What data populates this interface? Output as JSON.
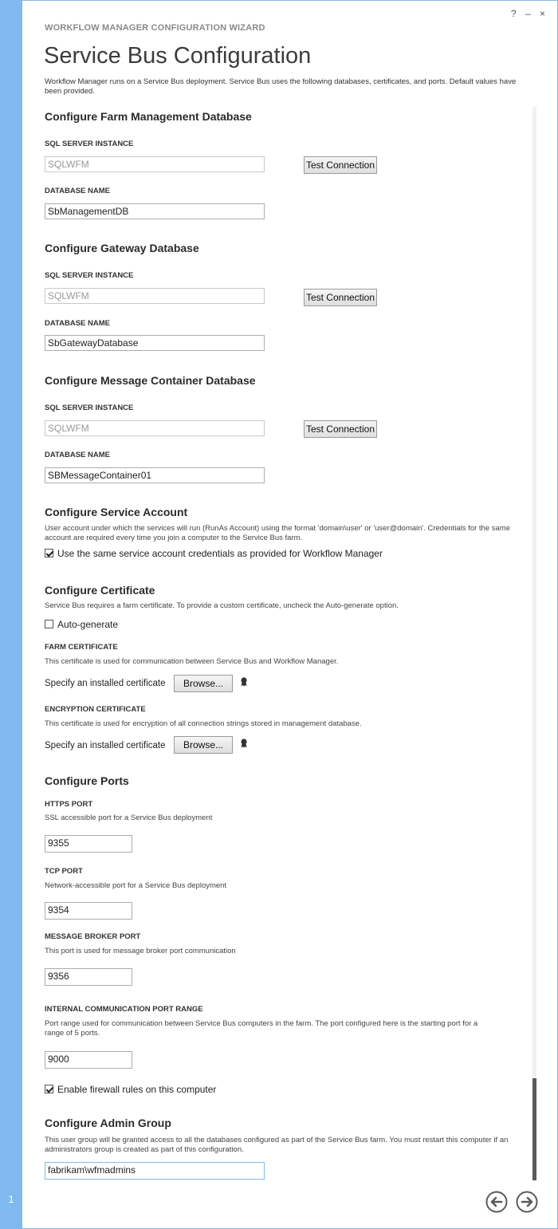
{
  "window": {
    "controls": [
      "?",
      "–",
      "×"
    ],
    "step_number": "1"
  },
  "header": {
    "wizard_title": "WORKFLOW MANAGER CONFIGURATION WIZARD",
    "page_title": "Service Bus Configuration",
    "intro": "Workflow Manager runs on a Service Bus deployment. Service Bus uses the following databases, certificates, and ports. Default values have been provided."
  },
  "farm_db": {
    "heading": "Configure Farm Management Database",
    "sql_label": "SQL SERVER INSTANCE",
    "sql_value": "SQLWFM",
    "test_button": "Test Connection",
    "db_label": "DATABASE NAME",
    "db_value": "SbManagementDB"
  },
  "gateway_db": {
    "heading": "Configure Gateway Database",
    "sql_label": "SQL SERVER INSTANCE",
    "sql_value": "SQLWFM",
    "test_button": "Test Connection",
    "db_label": "DATABASE NAME",
    "db_value": "SbGatewayDatabase"
  },
  "message_db": {
    "heading": "Configure Message Container Database",
    "sql_label": "SQL SERVER INSTANCE",
    "sql_value": "SQLWFM",
    "test_button": "Test Connection",
    "db_label": "DATABASE NAME",
    "db_value": "SBMessageContainer01"
  },
  "service_account": {
    "heading": "Configure Service Account",
    "desc": "User account under which the services will run (RunAs Account) using the format 'domain\\user' or 'user@domain'. Credentials for the same account are required every time you join a computer to the Service Bus farm.",
    "checkbox_label": "Use the same service account credentials as provided for Workflow Manager",
    "checked": true
  },
  "certificate": {
    "heading": "Configure Certificate",
    "desc": "Service Bus requires a farm certificate. To provide a custom certificate, uncheck the Auto-generate option.",
    "auto_label": "Auto-generate",
    "auto_checked": false,
    "farm_label": "FARM CERTIFICATE",
    "farm_desc": "This certificate is used for communication between Service Bus and Workflow Manager.",
    "farm_specify": "Specify an installed certificate",
    "farm_browse": "Browse...",
    "enc_label": "ENCRYPTION CERTIFICATE",
    "enc_desc": "This certificate is used for encryption of all connection strings stored in management database.",
    "enc_specify": "Specify an installed certificate",
    "enc_browse": "Browse..."
  },
  "ports": {
    "heading": "Configure Ports",
    "https_label": "HTTPS PORT",
    "https_desc": "SSL accessible port for a Service Bus deployment",
    "https_value": "9355",
    "tcp_label": "TCP PORT",
    "tcp_desc": "Network-accessible port for a Service Bus deployment",
    "tcp_value": "9354",
    "broker_label": "MESSAGE BROKER PORT",
    "broker_desc": "This port is used for message broker port communication",
    "broker_value": "9356",
    "internal_label": "INTERNAL COMMUNICATION PORT RANGE",
    "internal_desc": "Port range used for communication between Service Bus computers in the farm. The port configured here is the starting port for a range of 5 ports.",
    "internal_value": "9000",
    "firewall_label": "Enable firewall rules on this computer",
    "firewall_checked": true
  },
  "admin_group": {
    "heading": "Configure Admin Group",
    "desc": "This user group will be granted access to all the databases configured as part of the Service Bus farm. You must restart this computer if an administrators group is created as part of this configuration.",
    "value": "fabrikam\\wfmadmins"
  },
  "colors": {
    "accent": "#7fb9f0",
    "scroll_thumb": "#5a5a5a"
  }
}
